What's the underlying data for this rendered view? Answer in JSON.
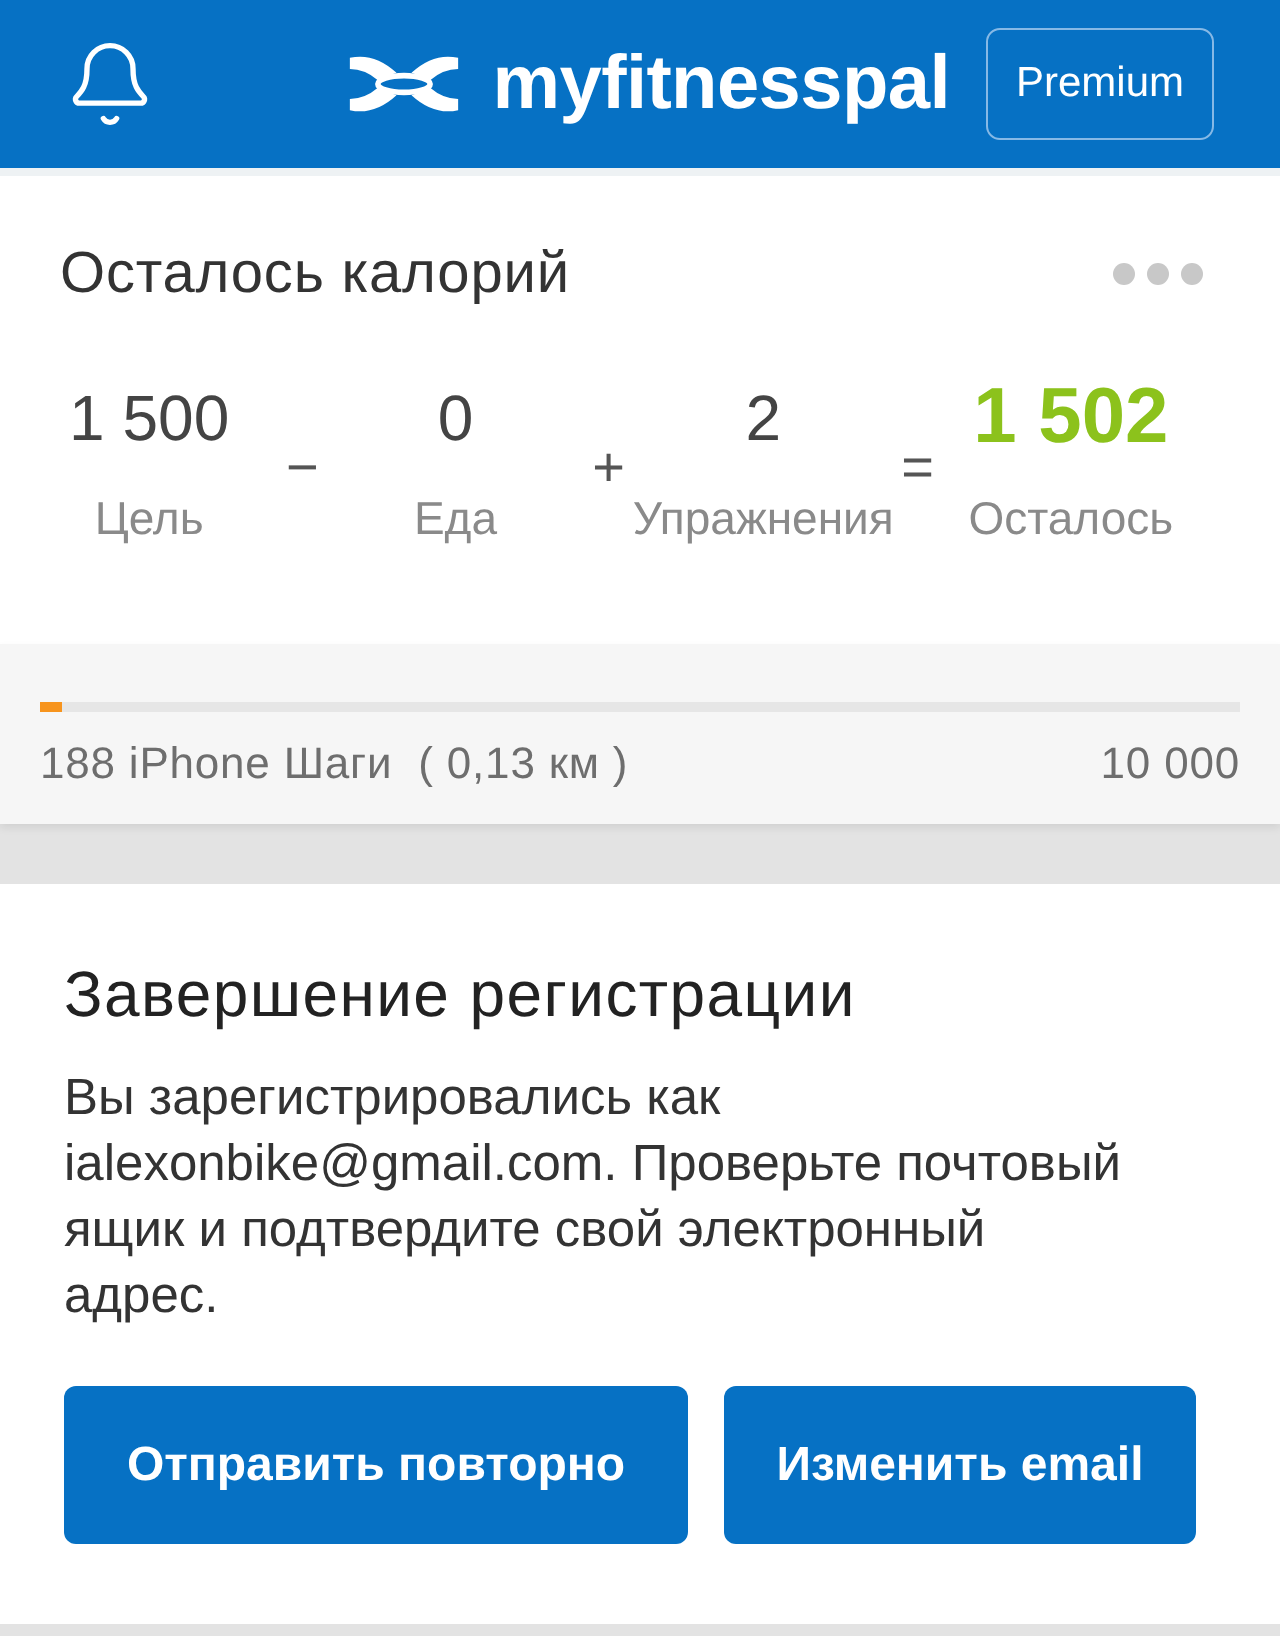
{
  "header": {
    "brand": "myfitnesspal",
    "premium_button": "Premium"
  },
  "calories": {
    "title": "Осталось калорий",
    "equation": [
      {
        "kind": "term",
        "value": "1 500",
        "label": "Цель"
      },
      {
        "kind": "operator",
        "symbol": "−"
      },
      {
        "kind": "term",
        "value": "0",
        "label": "Еда"
      },
      {
        "kind": "operator",
        "symbol": "+"
      },
      {
        "kind": "term",
        "value": "2",
        "label": "Упражнения"
      },
      {
        "kind": "operator",
        "symbol": "="
      },
      {
        "kind": "result",
        "value": "1 502",
        "label": "Осталось"
      }
    ]
  },
  "steps": {
    "level": 0.019,
    "label": "188 iPhone Шаги  ( 0,13 км )",
    "goal": "10 000"
  },
  "registration": {
    "title": "Завершение регистрации",
    "message": "Вы зарегистрировались как ialexonbike@gmail.com. Проверьте почтовый ящик и подтвердите свой электронный адрес.",
    "buttons": [
      "Отправить повторно",
      "Изменить email"
    ]
  }
}
